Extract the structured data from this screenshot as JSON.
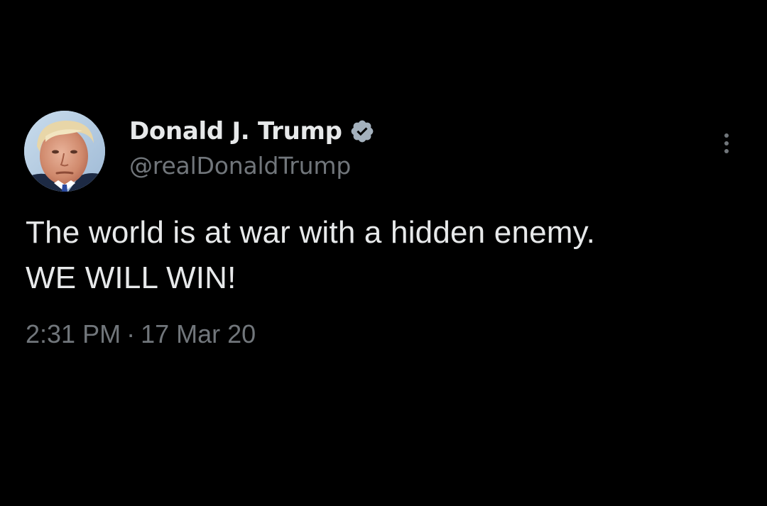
{
  "tweet": {
    "author": {
      "display_name": "Donald J. Trump",
      "handle": "@realDonaldTrump",
      "verified": true,
      "verified_badge_color": "#a4b1bd"
    },
    "text_lines": [
      "The world is at war with a hidden enemy.",
      "WE WILL WIN!"
    ],
    "time": "2:31 PM",
    "separator": "·",
    "date": "17 Mar 20"
  },
  "icons": {
    "more": "more-vertical-icon",
    "verified": "verified-badge-icon"
  },
  "colors": {
    "background": "#000000",
    "primary_text": "#e7e9ea",
    "secondary_text": "#71767b"
  }
}
